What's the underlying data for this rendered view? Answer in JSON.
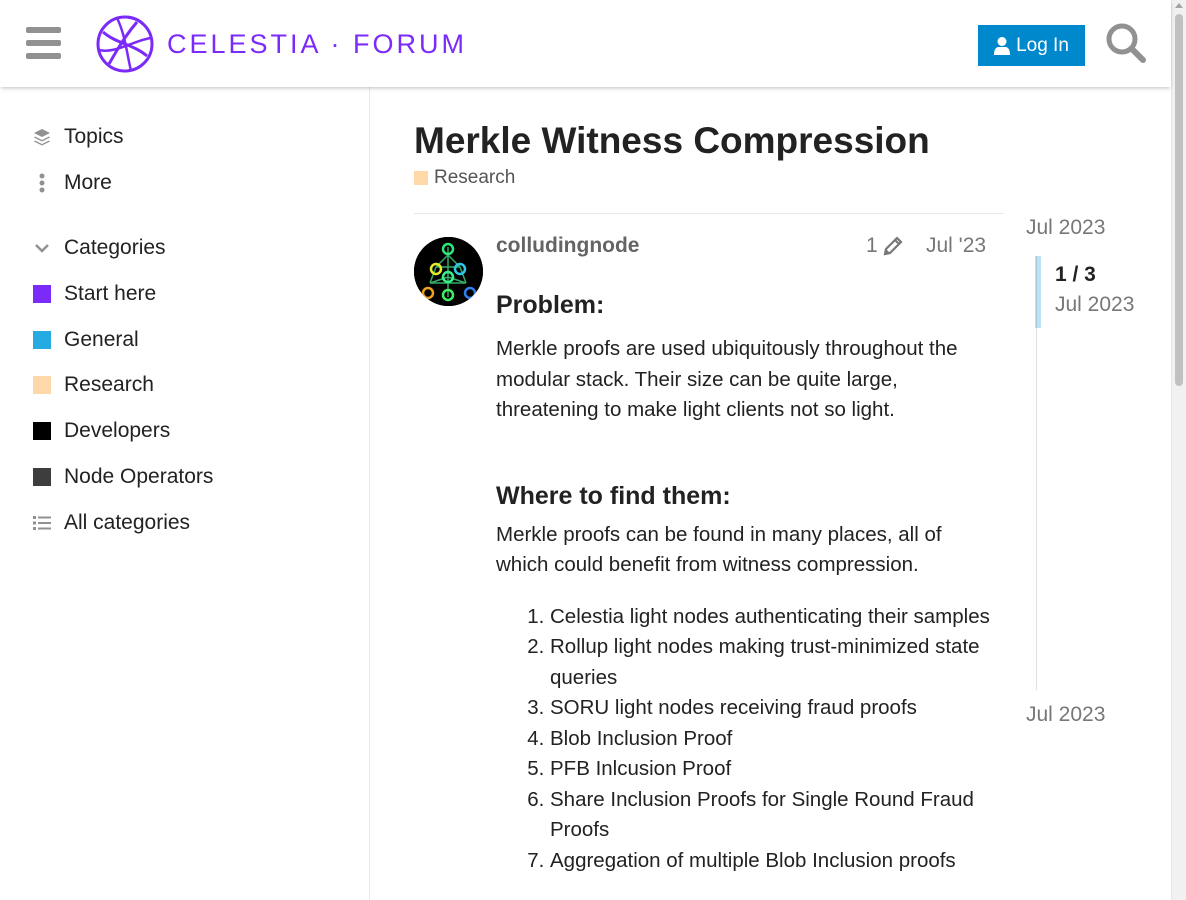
{
  "header": {
    "logo_text": "CELESTIA · FORUM",
    "login_label": "Log In",
    "brand_color": "#7b2bf9",
    "login_color": "#0088cc"
  },
  "sidebar": {
    "topics_label": "Topics",
    "more_label": "More",
    "categories_label": "Categories",
    "categories": [
      {
        "label": "Start here",
        "color": "#7b2bf9"
      },
      {
        "label": "General",
        "color": "#25aae1"
      },
      {
        "label": "Research",
        "color": "#fed8a8"
      },
      {
        "label": "Developers",
        "color": "#000000"
      },
      {
        "label": "Node Operators",
        "color": "#3d3d3d"
      }
    ],
    "all_categories_label": "All categories"
  },
  "topic": {
    "title": "Merkle Witness Compression",
    "category": "Research",
    "category_color": "#fed8a8"
  },
  "post": {
    "username": "colludingnode",
    "edit_count": "1",
    "date": "Jul '23",
    "heading1": "Problem:",
    "para1": "Merkle proofs are used ubiquitously throughout the modular stack. Their size can be quite large, threatening to make light clients not so light.",
    "heading2": "Where to find them:",
    "para2": "Merkle proofs can be found in many places, all of which could benefit from witness compression.",
    "list": [
      "Celestia light nodes authenticating their samples",
      "Rollup light nodes making trust-minimized state queries",
      "SORU light nodes receiving fraud proofs",
      "Blob Inclusion Proof",
      "PFB Inlcusion Proof",
      "Share Inclusion Proofs for Single Round Fraud Proofs",
      "Aggregation of multiple Blob Inclusion proofs"
    ]
  },
  "timeline": {
    "top_date": "Jul 2023",
    "position": "1 / 3",
    "position_date": "Jul 2023",
    "bottom_date": "Jul 2023"
  }
}
